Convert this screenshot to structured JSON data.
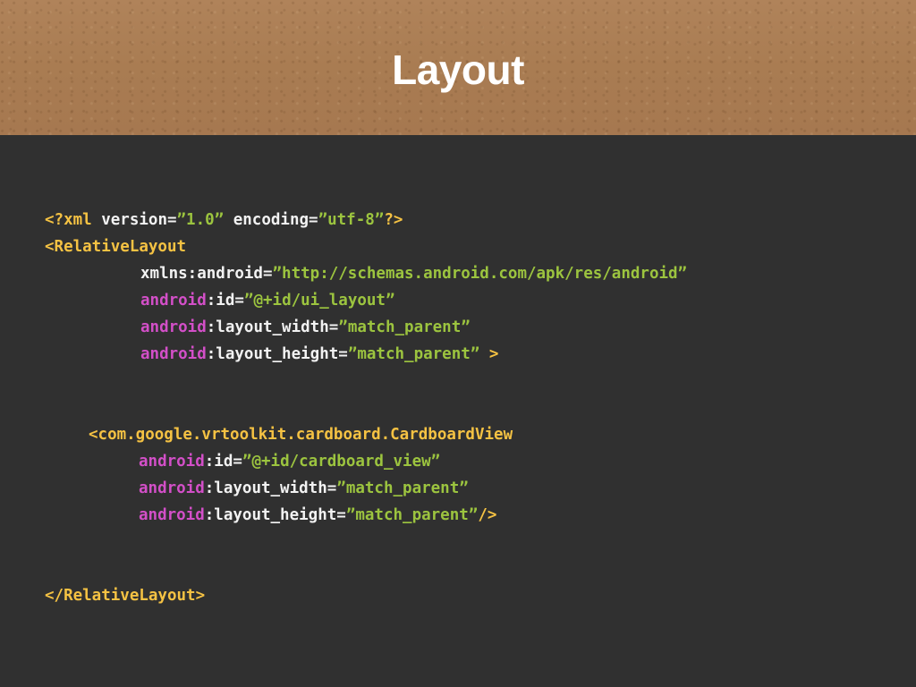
{
  "slide": {
    "title": "Layout"
  },
  "colors": {
    "header_background": "#a97c52",
    "body_background": "#303030",
    "tag": "#f5c243",
    "plain": "#f2f2f2",
    "string": "#9cc43f",
    "namespace": "#d34fc8"
  },
  "code": {
    "l1": {
      "open": "<?xml",
      "version_attr": " version=",
      "version_val": "”1.0”",
      "encoding_attr": " encoding=",
      "encoding_val": "”utf-8”",
      "close": "?>"
    },
    "l2": {
      "tag": "<RelativeLayout"
    },
    "l3": {
      "attr": "xmlns:android=",
      "val": "”http://schemas.android.com/apk/res/android”"
    },
    "l4": {
      "ns": "android",
      "attr": ":id=",
      "val": "”@+id/ui_layout”"
    },
    "l5": {
      "ns": "android",
      "attr": ":layout_width=",
      "val": "”match_parent”"
    },
    "l6": {
      "ns": "android",
      "attr": ":layout_height=",
      "val": "”match_parent”",
      "close": " >"
    },
    "l7": {
      "tag": "<com.google.vrtoolkit.cardboard.CardboardView"
    },
    "l8": {
      "ns": "android",
      "attr": ":id=",
      "val": "”@+id/cardboard_view”"
    },
    "l9": {
      "ns": "android",
      "attr": ":layout_width=",
      "val": "”match_parent”"
    },
    "l10": {
      "ns": "android",
      "attr": ":layout_height=",
      "val": "”match_parent”",
      "close": "/>"
    },
    "l11": {
      "tag": "</RelativeLayout>"
    }
  }
}
